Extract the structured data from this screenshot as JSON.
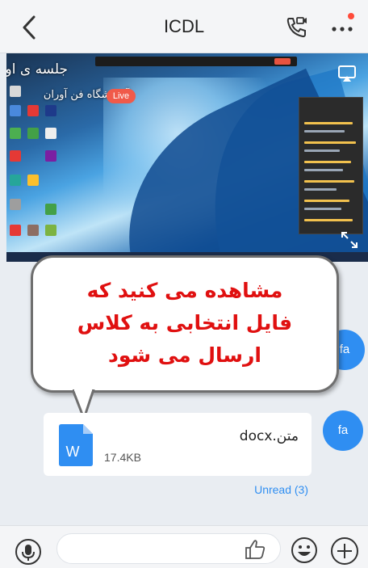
{
  "header": {
    "title": "ICDL",
    "back_icon": "chevron-left-icon",
    "call_icon": "video-phone-icon",
    "more_icon": "more-dots-icon",
    "notification_color": "#ff4b3a"
  },
  "stream": {
    "title": "جلسه ی اول",
    "subtitle": "آموزشگاه فن آوران",
    "live_label": "Live",
    "live_color": "#f05a4a",
    "cast_icon": "screen-cast-icon",
    "expand_icon": "expand-arrows-icon"
  },
  "overlay": {
    "lines": [
      "مشاهده می کنید که",
      "فایل انتخابی به کلاس",
      "ارسال می شود"
    ],
    "text_color": "#e01010"
  },
  "messages": [
    {
      "avatar_label": "fa"
    },
    {
      "avatar_label": "fa",
      "file_name": "متن.docx",
      "file_size": "17.4KB",
      "file_icon": "word-document-icon",
      "icon_letter": "W"
    }
  ],
  "unread_label": "Unread (3)",
  "composer": {
    "input_value": "",
    "mic_icon": "microphone-icon",
    "like_icon": "thumbs-up-icon",
    "emoji_icon": "smiley-icon",
    "plus_icon": "plus-circle-icon"
  },
  "accent_color": "#2f8ef2"
}
